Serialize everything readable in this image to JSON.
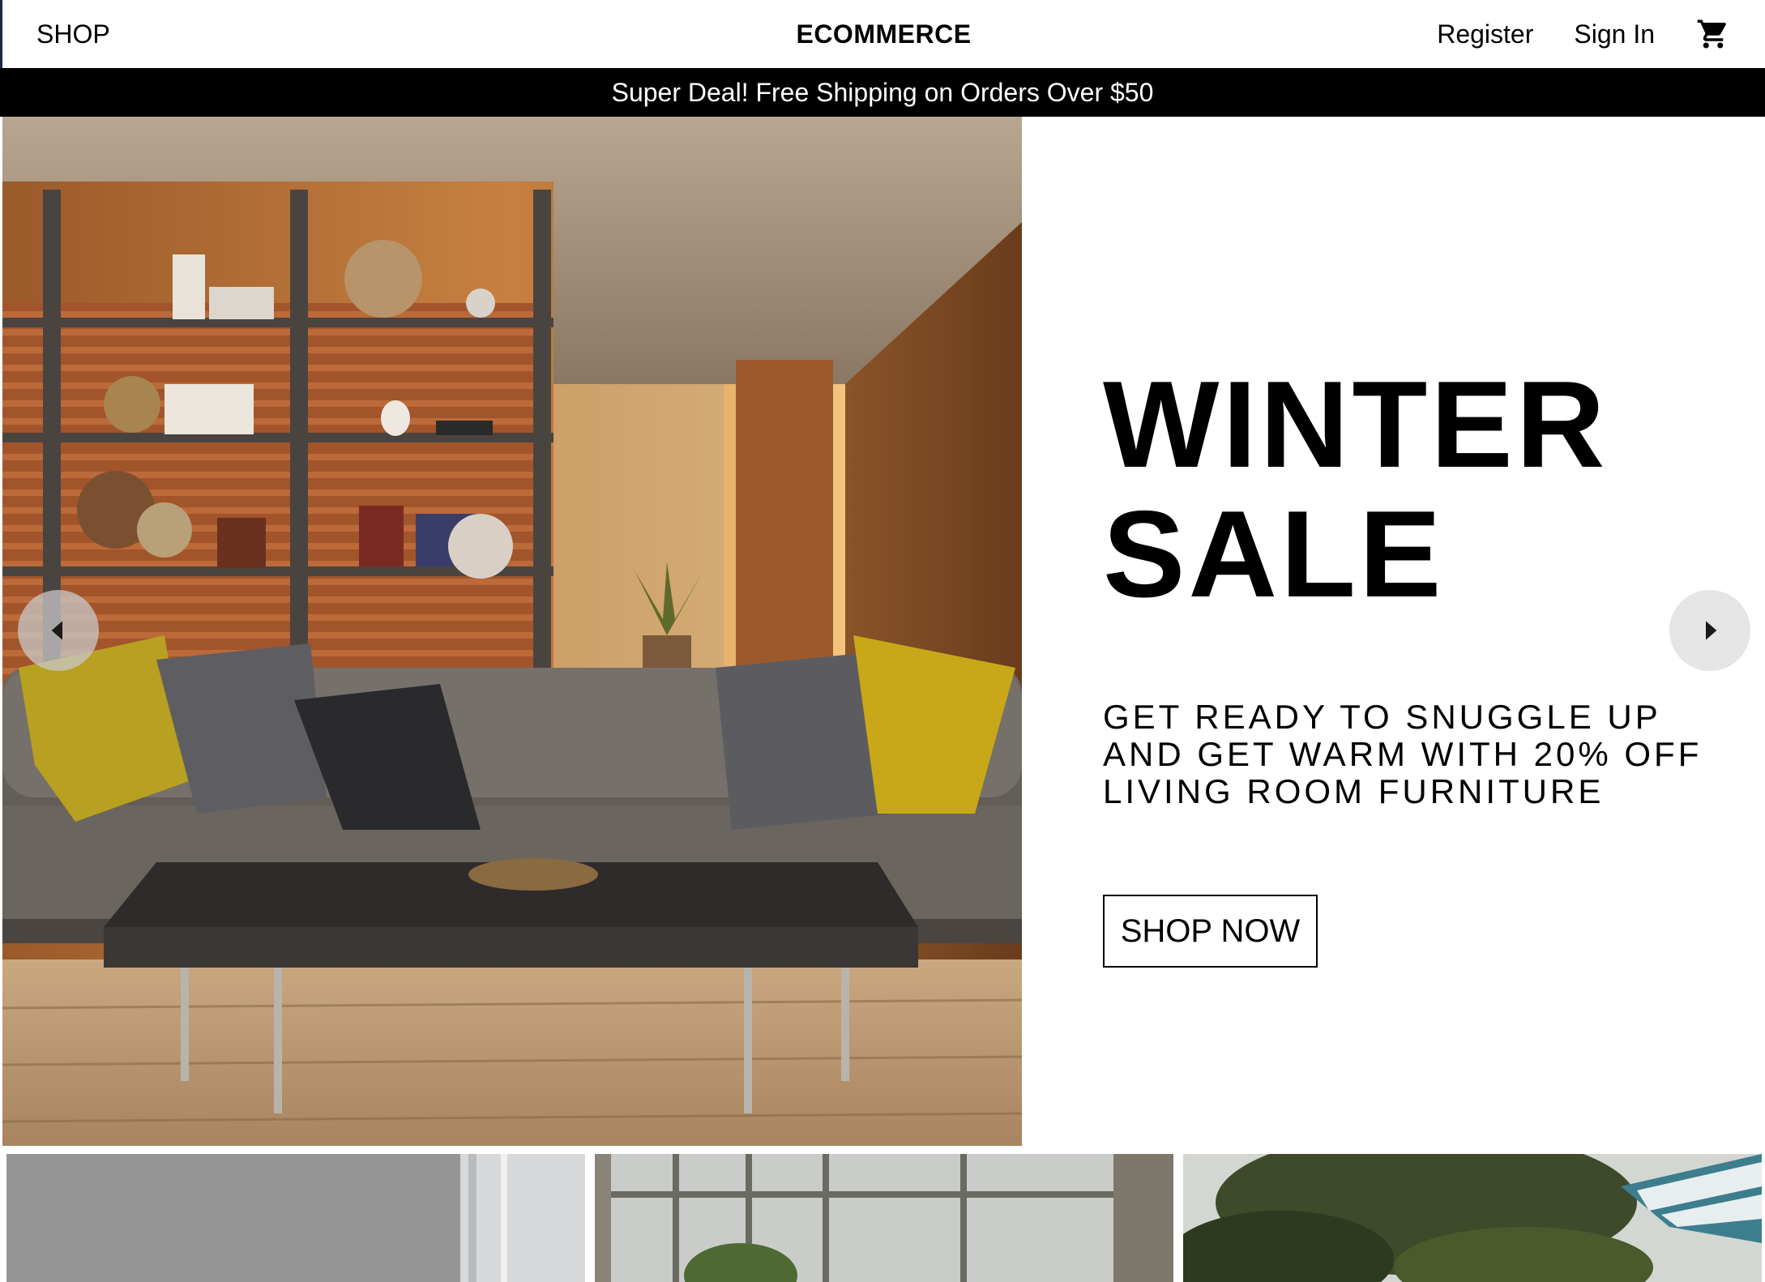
{
  "nav": {
    "left_label": "SHOP",
    "brand": "ECOMMERCE",
    "register": "Register",
    "signin": "Sign In",
    "cart_icon": "shopping-cart-icon"
  },
  "announcement": {
    "text": "Super Deal! Free Shipping on Orders Over $50"
  },
  "hero": {
    "title_line1": "WINTER",
    "title_line2": "SALE",
    "description": "GET READY TO SNUGGLE UP AND GET WARM WITH 20% OFF LIVING ROOM FURNITURE",
    "cta_label": "SHOP NOW",
    "prev_icon": "chevron-left-icon",
    "next_icon": "chevron-right-icon"
  },
  "colors": {
    "announcement_bg": "#000000",
    "text": "#000000",
    "background": "#ffffff"
  }
}
